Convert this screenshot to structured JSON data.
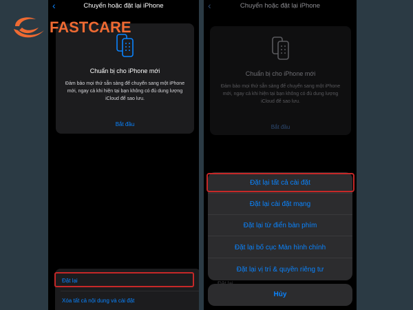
{
  "brand": {
    "logo_text": "FASTCARE",
    "color": "#ef6a32"
  },
  "colors": {
    "accent": "#0a84ff",
    "highlight": "#c62828",
    "card_bg": "#1c1c1e",
    "sheet_bg": "#2c2c2e"
  },
  "left_screen": {
    "nav": {
      "back_icon": "chevron-left-icon",
      "back_glyph": "‹",
      "title": "Chuyển hoặc đặt lại iPhone"
    },
    "card": {
      "icon": "two-phones-icon",
      "title": "Chuẩn bị cho iPhone mới",
      "description": "Đảm bảo mọi thứ sẵn sàng để chuyển sang một iPhone mới, ngay cả khi hiện tại bạn không có đủ dung lượng iCloud để sao lưu.",
      "action": "Bắt đầu"
    },
    "list": {
      "reset": "Đặt lại",
      "erase_all": "Xóa tất cả nội dung và cài đặt"
    }
  },
  "right_screen": {
    "nav": {
      "back_icon": "chevron-left-icon",
      "back_glyph": "‹",
      "title": "Chuyển hoặc đặt lại iPhone"
    },
    "card": {
      "icon": "two-phones-icon",
      "title": "Chuẩn bị cho iPhone mới",
      "description": "Đảm bảo mọi thứ sẵn sàng để chuyển sang một iPhone mới, ngay cả khi hiện tại bạn không có đủ dung lượng iCloud để sao lưu.",
      "action": "Bắt đầu"
    },
    "behind_text": "Đặt lại",
    "action_sheet": {
      "items": [
        "Đặt lại tất cả cài đặt",
        "Đặt lại cài đặt mạng",
        "Đặt lại từ điển bàn phím",
        "Đặt lại bố cục Màn hình chính",
        "Đặt lại vị trí & quyền riêng tư"
      ],
      "cancel": "Hủy"
    }
  }
}
